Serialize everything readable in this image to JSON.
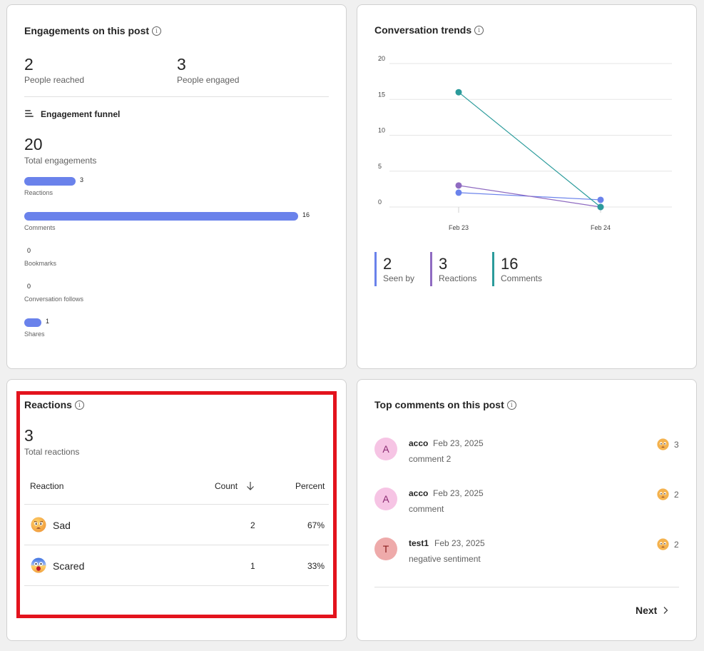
{
  "engagements": {
    "title": "Engagements on this post",
    "people_reached_value": "2",
    "people_reached_label": "People reached",
    "people_engaged_value": "3",
    "people_engaged_label": "People engaged",
    "funnel_title": "Engagement funnel",
    "total_value": "20",
    "total_label": "Total engagements",
    "funnel": [
      {
        "label": "Reactions",
        "value": "3",
        "count": 3
      },
      {
        "label": "Comments",
        "value": "16",
        "count": 16
      },
      {
        "label": "Bookmarks",
        "value": "0",
        "count": 0
      },
      {
        "label": "Conversation follows",
        "value": "0",
        "count": 0
      },
      {
        "label": "Shares",
        "value": "1",
        "count": 1
      }
    ]
  },
  "trends": {
    "title": "Conversation trends",
    "legend": [
      {
        "value": "2",
        "label": "Seen by",
        "color": "#6a82eb"
      },
      {
        "value": "3",
        "label": "Reactions",
        "color": "#8f6bc1"
      },
      {
        "value": "16",
        "label": "Comments",
        "color": "#2b9b9b"
      }
    ]
  },
  "chart_data": {
    "type": "line",
    "title": "Conversation trends",
    "categories": [
      "Feb 23",
      "Feb 24"
    ],
    "yticks": [
      "20",
      "15",
      "10",
      "5",
      "0"
    ],
    "ylim": [
      0,
      20
    ],
    "grid": true,
    "series": [
      {
        "name": "Seen by",
        "values": [
          2,
          1
        ],
        "color": "#6a82eb"
      },
      {
        "name": "Reactions",
        "values": [
          3,
          0
        ],
        "color": "#8f6bc1"
      },
      {
        "name": "Comments",
        "values": [
          16,
          0
        ],
        "color": "#2b9b9b"
      }
    ]
  },
  "reactions": {
    "title": "Reactions",
    "total_value": "3",
    "total_label": "Total reactions",
    "col_reaction": "Reaction",
    "col_count": "Count",
    "col_percent": "Percent",
    "rows": [
      {
        "name": "Sad",
        "count": "2",
        "percent": "67%"
      },
      {
        "name": "Scared",
        "count": "1",
        "percent": "33%"
      }
    ]
  },
  "top_comments": {
    "title": "Top comments on this post",
    "items": [
      {
        "initial": "A",
        "user": "acco",
        "date": "Feb 23, 2025",
        "text": "comment 2",
        "reactions": "3"
      },
      {
        "initial": "A",
        "user": "acco",
        "date": "Feb 23, 2025",
        "text": "comment",
        "reactions": "2"
      },
      {
        "initial": "T",
        "user": "test1",
        "date": "Feb 23, 2025",
        "text": "negative sentiment",
        "reactions": "2"
      }
    ],
    "next_label": "Next"
  }
}
